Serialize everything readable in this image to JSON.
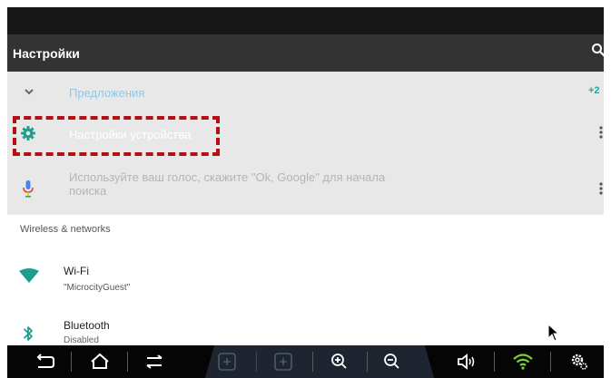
{
  "toolbar": {
    "title": "Настройки"
  },
  "suggestions": {
    "label": "Предложения",
    "count": "+2",
    "items": [
      {
        "title": "Настройки устройства"
      },
      {
        "title": "Используйте ваш голос, скажите \"Ok, Google\" для начала поиска"
      }
    ]
  },
  "section": {
    "title": "Wireless & networks"
  },
  "settings": [
    {
      "title": "Wi-Fi",
      "summary": "\"MicrocityGuest\""
    },
    {
      "title": "Bluetooth",
      "summary": "Disabled"
    }
  ],
  "nav": {
    "buttons": [
      "back-icon",
      "home-icon",
      "recents-icon",
      "screenshot-icon",
      "screenrecord-icon",
      "zoom-in-icon",
      "zoom-out-icon",
      "volume-icon",
      "wifi-status-icon",
      "settings-icon"
    ]
  },
  "colors": {
    "toolbar": "#333333",
    "suggestion_label": "#8fc8e8",
    "accent": "#22a99c",
    "highlight": "#b30f14"
  }
}
